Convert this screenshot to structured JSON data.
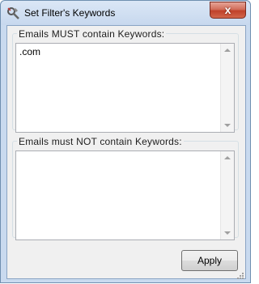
{
  "window": {
    "title": "Set Filter's Keywords",
    "close_label": "x"
  },
  "must_contain": {
    "label": "Emails MUST contain Keywords:",
    "value": ".com"
  },
  "must_not_contain": {
    "label": "Emails must NOT contain Keywords:",
    "value": ""
  },
  "buttons": {
    "apply_label": "Apply"
  }
}
